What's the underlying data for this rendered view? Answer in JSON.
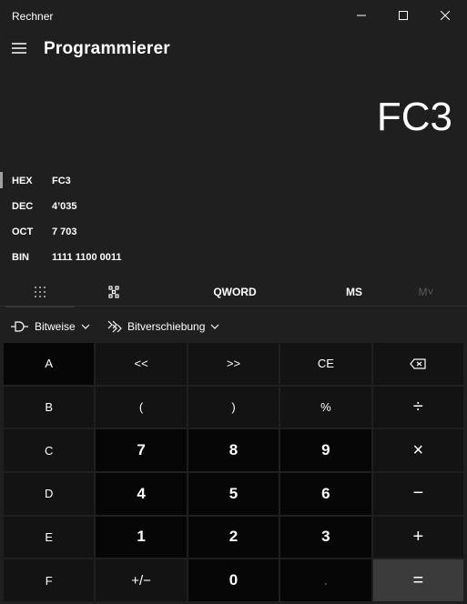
{
  "window": {
    "title": "Rechner"
  },
  "header": {
    "mode_title": "Programmierer"
  },
  "display": {
    "value": "FC3"
  },
  "radix": [
    {
      "name": "HEX",
      "value": "FC3",
      "selected": true
    },
    {
      "name": "DEC",
      "value": "4’035",
      "selected": false
    },
    {
      "name": "OCT",
      "value": "7 703",
      "selected": false
    },
    {
      "name": "BIN",
      "value": "1111 1100 0011",
      "selected": false
    }
  ],
  "memory_row": {
    "word_size": "QWORD",
    "ms": "MS",
    "mv": "M˅"
  },
  "tools": {
    "bitwise": "Bitweise",
    "bitshift": "Bitverschiebung"
  },
  "keys": [
    [
      "A",
      "<<",
      ">>",
      "CE",
      "⌫"
    ],
    [
      "B",
      "(",
      ")",
      "%",
      "÷"
    ],
    [
      "C",
      "7",
      "8",
      "9",
      "×"
    ],
    [
      "D",
      "4",
      "5",
      "6",
      "−"
    ],
    [
      "E",
      "1",
      "2",
      "3",
      "+"
    ],
    [
      "F",
      "+/−",
      "0",
      ".",
      "="
    ]
  ],
  "colors": {
    "background": "#1f1f1f",
    "digit_key": "#060606",
    "function_key": "#131313",
    "equals_key": "#3b3b3b"
  }
}
